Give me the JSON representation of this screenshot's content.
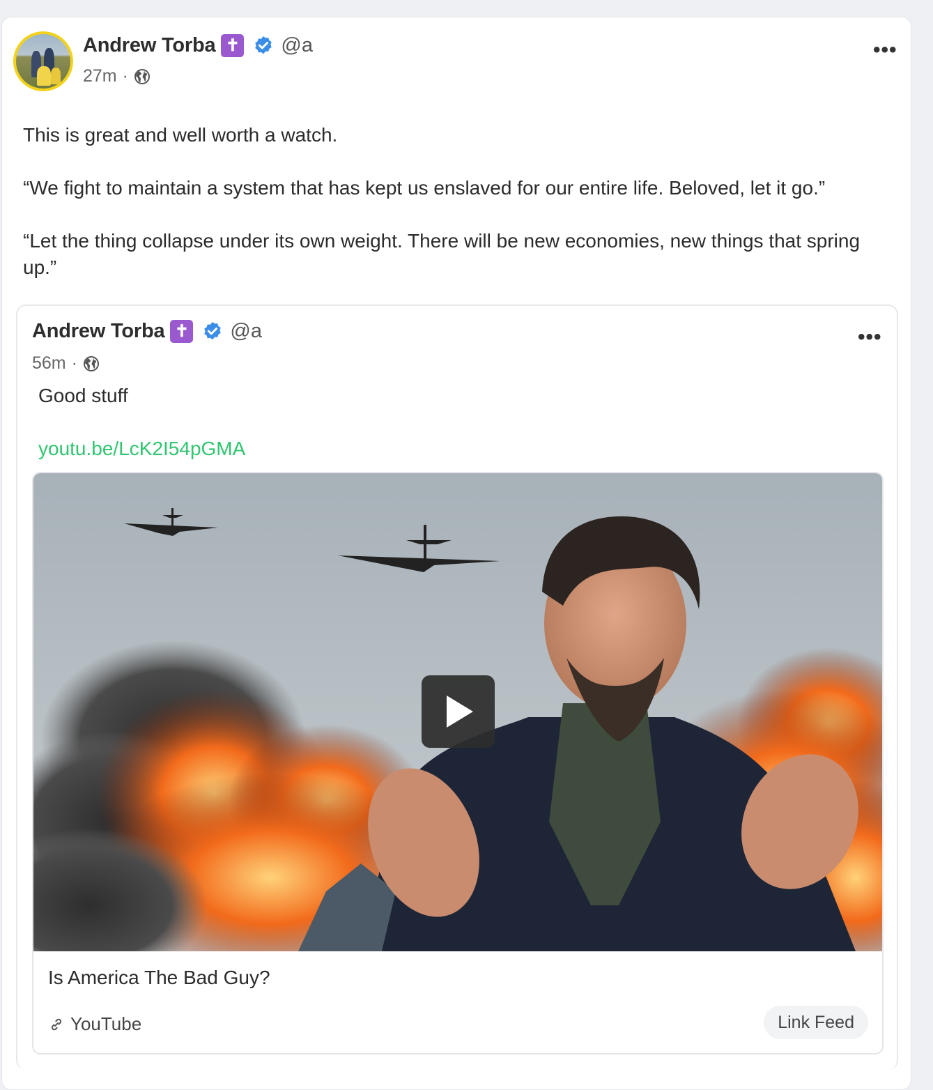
{
  "post": {
    "author": "Andrew Torba",
    "badge": "✝",
    "handle": "@a",
    "time": "27m",
    "separator": "·",
    "more": "•••",
    "paragraphs": [
      "This is great and well worth a watch.",
      "“We fight to maintain a system that has kept us enslaved for our entire life. Beloved, let it go.”",
      "“Let the thing collapse under its own weight. There will be new economies, new things that spring up.”"
    ]
  },
  "quote": {
    "author": "Andrew Torba",
    "badge": "✝",
    "handle": "@a",
    "time": "56m",
    "separator": "·",
    "more": "•••",
    "text": "Good stuff",
    "link": "youtu.be/LcK2I54pGMA",
    "card": {
      "title": "Is America The Bad Guy?",
      "source": "YouTube",
      "feed_button": "Link Feed"
    }
  },
  "colors": {
    "link": "#30c56f",
    "verified": "#3b8ee8",
    "badge": "#9b59d0",
    "avatar_ring": "#f2d21b"
  },
  "icons": [
    "verified-icon",
    "globe-icon",
    "more-icon",
    "play-icon",
    "link-icon"
  ]
}
